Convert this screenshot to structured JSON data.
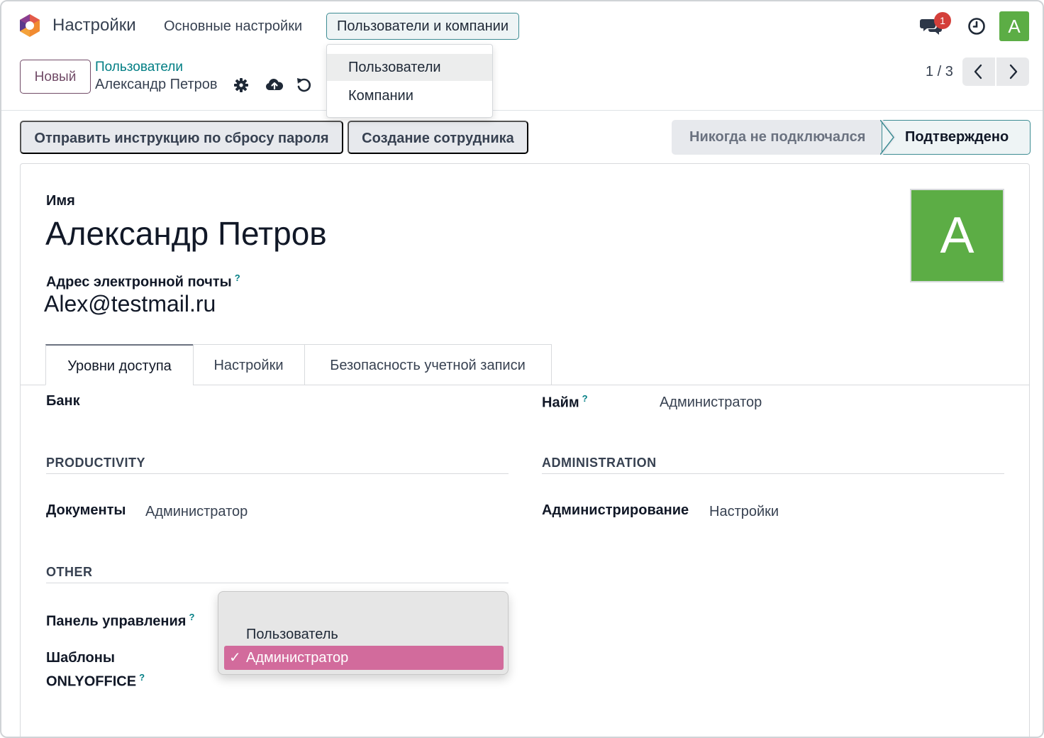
{
  "navbar": {
    "app_name": "Настройки",
    "menu_main": "Основные настройки",
    "menu_users": "Пользователи и компании",
    "chat_badge": "1",
    "user_initial": "A"
  },
  "users_menu": {
    "items": [
      "Пользователи",
      "Компании"
    ]
  },
  "control_panel": {
    "new_button": "Новый",
    "breadcrumb_parent": "Пользователи",
    "breadcrumb_current": "Александр Петров",
    "pager": "1 / 3"
  },
  "actions": {
    "reset_password": "Отправить инструкцию по сбросу пароля",
    "create_employee": "Создание сотрудника"
  },
  "status": {
    "never_connected": "Никогда не подключался",
    "confirmed": "Подтверждено",
    "active": "Подтверждено"
  },
  "form": {
    "name_label": "Имя",
    "name_value": "Александр Петров",
    "email_label": "Адрес электронной почты",
    "help_mark": "?",
    "email_value": "Alex@testmail.ru",
    "avatar_initial": "A"
  },
  "tabs": [
    "Уровни доступа",
    "Настройки",
    "Безопасность учетной записи"
  ],
  "access": {
    "bank_label": "Банк",
    "hiring_label": "Найм",
    "hiring_value": "Администратор",
    "productivity_title": "PRODUCTIVITY",
    "documents_label": "Документы",
    "documents_value": "Администратор",
    "administration_title": "ADMINISTRATION",
    "admin_label": "Администрирование",
    "admin_value": "Настройки",
    "other_title": "OTHER",
    "dashboard_label": "Панель управления",
    "templates_label_1": "Шаблоны",
    "templates_label_2": "ONLYOFFICE"
  },
  "select_popup": {
    "options": [
      "Пользователь",
      "Администратор"
    ],
    "selected": "Администратор",
    "check_mark": "✓"
  },
  "colors": {
    "accent_teal": "#017e84",
    "brand_purple": "#714b67",
    "avatar_green": "#5cad45",
    "badge_red": "#d43f3a",
    "selection_pink": "#d26b9c"
  }
}
